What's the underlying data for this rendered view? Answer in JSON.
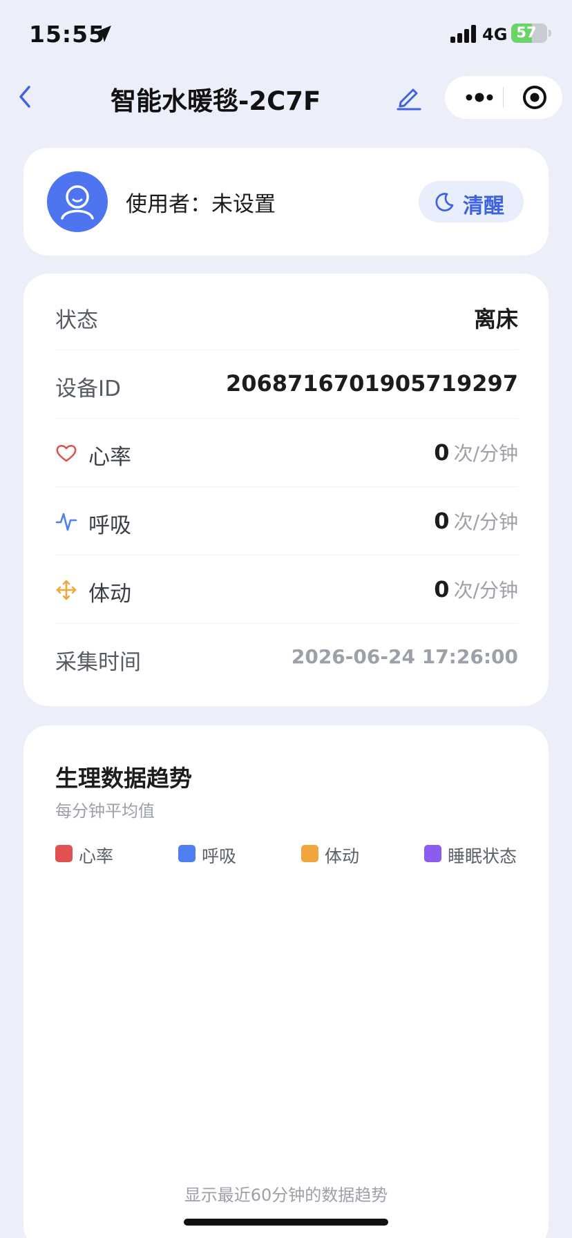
{
  "status_bar": {
    "time": "15:55",
    "network": "4G",
    "battery_level": "57",
    "battery_fraction": 0.57,
    "icons": [
      "location-arrow-icon",
      "signal-icon",
      "battery-charging-icon"
    ]
  },
  "nav": {
    "title": "智能水暖毯-2C7F",
    "icons": [
      "chevron-left-icon",
      "edit-pencil-icon",
      "more-dots-icon",
      "target-close-icon"
    ]
  },
  "user": {
    "label": "使用者：未设置",
    "avatar_icon": "user-avatar-icon",
    "state_button": {
      "icon": "moon-icon",
      "label": "清醒"
    }
  },
  "info": {
    "rows": [
      {
        "label": "状态",
        "value": "离床"
      },
      {
        "label": "设备ID",
        "value": "2068716701905719297"
      },
      {
        "label": "心率",
        "icon": "heart-icon",
        "value": "0",
        "unit": "次/分钟"
      },
      {
        "label": "呼吸",
        "icon": "pulse-wave-icon",
        "value": "0",
        "unit": "次/分钟"
      },
      {
        "label": "体动",
        "icon": "move-arrows-icon",
        "value": "0",
        "unit": "次/分钟"
      },
      {
        "label": "采集时间",
        "value": "2026-06-24 17:26:00"
      }
    ]
  },
  "trend": {
    "title": "生理数据趋势",
    "subtitle": "每分钟平均值",
    "legend": [
      {
        "label": "心率",
        "color": "#e05252"
      },
      {
        "label": "呼吸",
        "color": "#4f7ff0"
      },
      {
        "label": "体动",
        "color": "#f0a63c"
      },
      {
        "label": "睡眠状态",
        "color": "#8b5cf0"
      }
    ],
    "footer": "显示最近60分钟的数据趋势"
  },
  "colors": {
    "accent": "#4f74f0",
    "background": "#eceff9",
    "card": "#ffffff"
  }
}
